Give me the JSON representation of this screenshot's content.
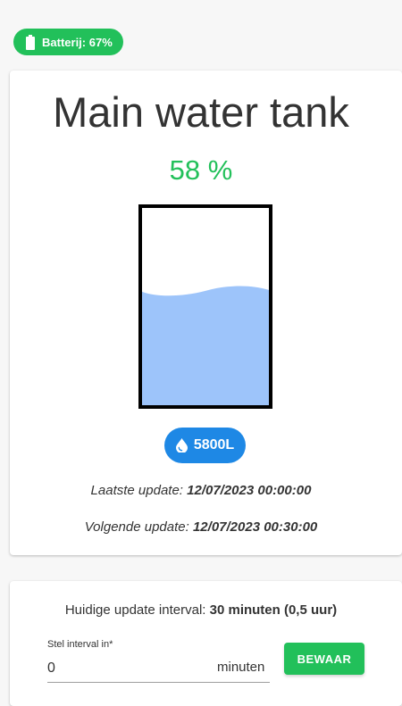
{
  "battery": {
    "label": "Batterij: 67%",
    "level": 0.67,
    "color": "#22c05a"
  },
  "tank": {
    "title": "Main water tank",
    "percent_label": "58 %",
    "fill_level": 0.58,
    "water_color": "#9dc4fa",
    "volume_label": "5800L",
    "volume_color": "#1e88e5",
    "volume_icon": "water-drop-icon"
  },
  "updates": {
    "last_label": "Laatste update:",
    "last_value": "12/07/2023 00:00:00",
    "next_label": "Volgende update:",
    "next_value": "12/07/2023 00:30:00"
  },
  "interval": {
    "current_label": "Huidige update interval:",
    "current_value": "30 minuten (0,5 uur)",
    "field_label": "Stel interval in*",
    "field_value": "0",
    "field_suffix": "minuten",
    "save_label": "BEWAAR",
    "save_color": "#22c05a"
  }
}
